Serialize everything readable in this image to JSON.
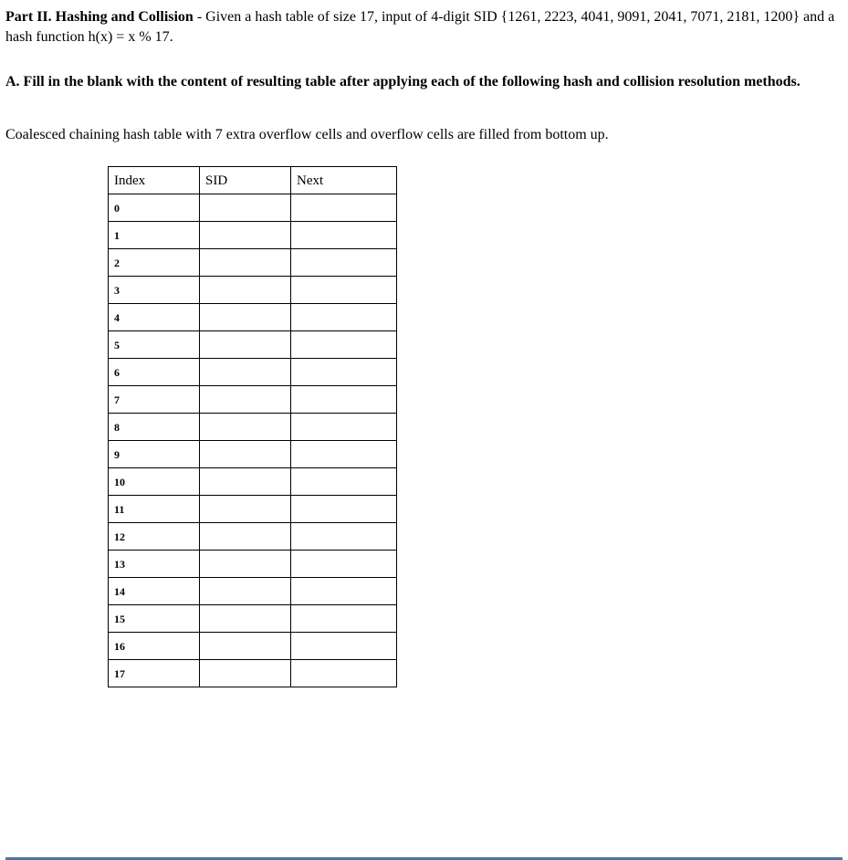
{
  "intro": {
    "lead_bold": "Part II. Hashing and Collision",
    "lead_rest": " - Given a hash table of size 17, input of 4-digit SID {1261, 2223, 4041, 9091, 2041, 7071, 2181, 1200} and a hash function h(x) = x % 17."
  },
  "section_a": "A. Fill in the blank with the content of resulting table after applying each of the following hash and collision resolution methods.",
  "chaining_desc": "Coalesced chaining hash table with 7 extra overflow cells and overflow cells are filled from bottom up.",
  "table": {
    "headers": {
      "index": "Index",
      "sid": "SID",
      "next": "Next"
    },
    "rows": [
      {
        "index": "0",
        "sid": "",
        "next": ""
      },
      {
        "index": "1",
        "sid": "",
        "next": ""
      },
      {
        "index": "2",
        "sid": "",
        "next": ""
      },
      {
        "index": "3",
        "sid": "",
        "next": ""
      },
      {
        "index": "4",
        "sid": "",
        "next": ""
      },
      {
        "index": "5",
        "sid": "",
        "next": ""
      },
      {
        "index": "6",
        "sid": "",
        "next": ""
      },
      {
        "index": "7",
        "sid": "",
        "next": ""
      },
      {
        "index": "8",
        "sid": "",
        "next": ""
      },
      {
        "index": "9",
        "sid": "",
        "next": ""
      },
      {
        "index": "10",
        "sid": "",
        "next": ""
      },
      {
        "index": "11",
        "sid": "",
        "next": ""
      },
      {
        "index": "12",
        "sid": "",
        "next": ""
      },
      {
        "index": "13",
        "sid": "",
        "next": ""
      },
      {
        "index": "14",
        "sid": "",
        "next": ""
      },
      {
        "index": "15",
        "sid": "",
        "next": ""
      },
      {
        "index": "16",
        "sid": "",
        "next": ""
      },
      {
        "index": "17",
        "sid": "",
        "next": ""
      }
    ]
  }
}
